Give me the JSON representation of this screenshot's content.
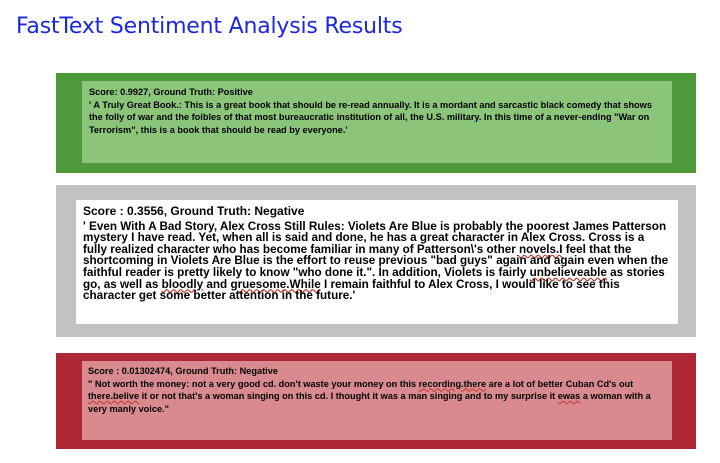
{
  "title": "FastText Sentiment Analysis Results",
  "panels": [
    {
      "score_line": "Score: 0.9927, Ground Truth: Positive",
      "review": "' A Truly Great Book.: This is a great book that should be re-read annually. It is a mordant and sarcastic black comedy that shows the folly of war and the foibles of that most bureaucratic institution of all, the U.S. military. In this time of a never-ending \"War on Terrorism\", this is a book that should be read by everyone.'",
      "color": "#4e9a3a"
    },
    {
      "score_line": "Score : 0.3556, Ground Truth: Negative",
      "review_parts": [
        "' Even With A Bad Story, Alex Cross Still Rules: Violets Are Blue is probably the poorest James Patterson mystery I have read. Yet, when all is said and done, he has a great character in Alex Cross. Cross is a fully realized character who has become familiar in many of Patterson\\'s other ",
        "novels.I",
        " feel that the shortcoming in Violets Are Blue is the effort to reuse previous \"bad guys\" again and again even when the faithful reader is pretty likely to know \"who done it.\". In addition, Violets is fairly ",
        "unbelieveable",
        " as stories go, as well as ",
        "bloodly",
        " and ",
        "gruesome.While",
        " I remain faithful to Alex Cross, I would like to see this character get some better attention in the future.'"
      ],
      "color": "#c2c2c2"
    },
    {
      "score_line": "Score : 0.01302474, Ground Truth: Negative",
      "review_parts": [
        "\" Not worth the money: not a very good cd. don't waste your money on this ",
        "recording.there",
        " are a lot of better Cuban Cd's out ",
        "there.belive",
        " it or not that's a woman singing on this cd. I thought it was a man singing and to my surprise it ",
        "ewas",
        " a woman with a very manly voice.\""
      ],
      "color": "#ad2834"
    }
  ]
}
